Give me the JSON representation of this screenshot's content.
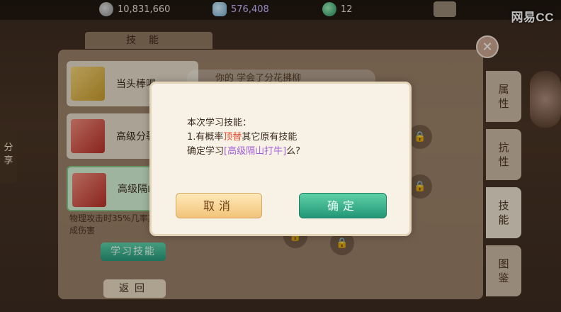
{
  "topbar": {
    "silver": "10,831,660",
    "gold": "576,408",
    "gems": "12",
    "brand": "网易CC"
  },
  "panel": {
    "title": "技能",
    "share": "分享",
    "notice": "你的 学会了分花拂柳",
    "tabs": [
      "属性",
      "抗性",
      "技能",
      "图鉴"
    ]
  },
  "skills": [
    {
      "name": "当头棒喝",
      "icon": "yellow-book-icon"
    },
    {
      "name": "高级分裂",
      "icon": "red-book-icon"
    },
    {
      "name": "高级隔山",
      "icon": "red-book-icon"
    }
  ],
  "skill_desc": "物理攻击时35%几率某个目标造成伤害",
  "buttons": {
    "learn": "学习技能",
    "back": "返回"
  },
  "dialog": {
    "line1": "本次学习技能：",
    "line2_prefix": "1.有概率",
    "line2_highlight": "顶替",
    "line2_suffix": "其它原有技能",
    "line3_prefix": "确定学习",
    "line3_skill": "[高级隔山打牛]",
    "line3_suffix": "么?",
    "cancel": "取消",
    "confirm": "确定"
  },
  "colors": {
    "confirm_button": "#2fae88",
    "cancel_button": "#f7d394",
    "highlight_red": "#e84a31",
    "highlight_purple": "#a05fd6"
  }
}
